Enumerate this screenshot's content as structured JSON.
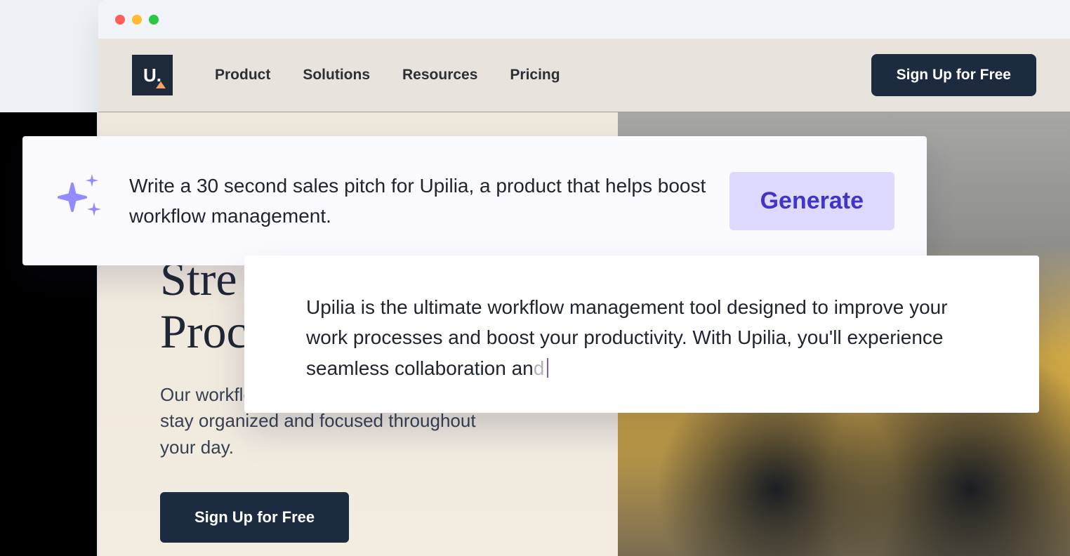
{
  "brand": {
    "letter": "U."
  },
  "nav": {
    "items": [
      "Product",
      "Solutions",
      "Resources",
      "Pricing"
    ],
    "cta": "Sign Up for Free"
  },
  "hero": {
    "title_line1": "Stre",
    "title_line2": "Proc",
    "subtitle": "Our workflow management tool helps you stay organized and focused throughout your day.",
    "cta": "Sign Up for Free"
  },
  "prompt": {
    "text": "Write a 30 second sales pitch for Upilia, a product that helps boost workflow management.",
    "button": "Generate"
  },
  "output": {
    "main": "Upilia is the ultimate workflow management tool designed to improve your work processes and boost your productivity. With Upilia, you'll experience seamless collaboration an",
    "tail": "d"
  }
}
